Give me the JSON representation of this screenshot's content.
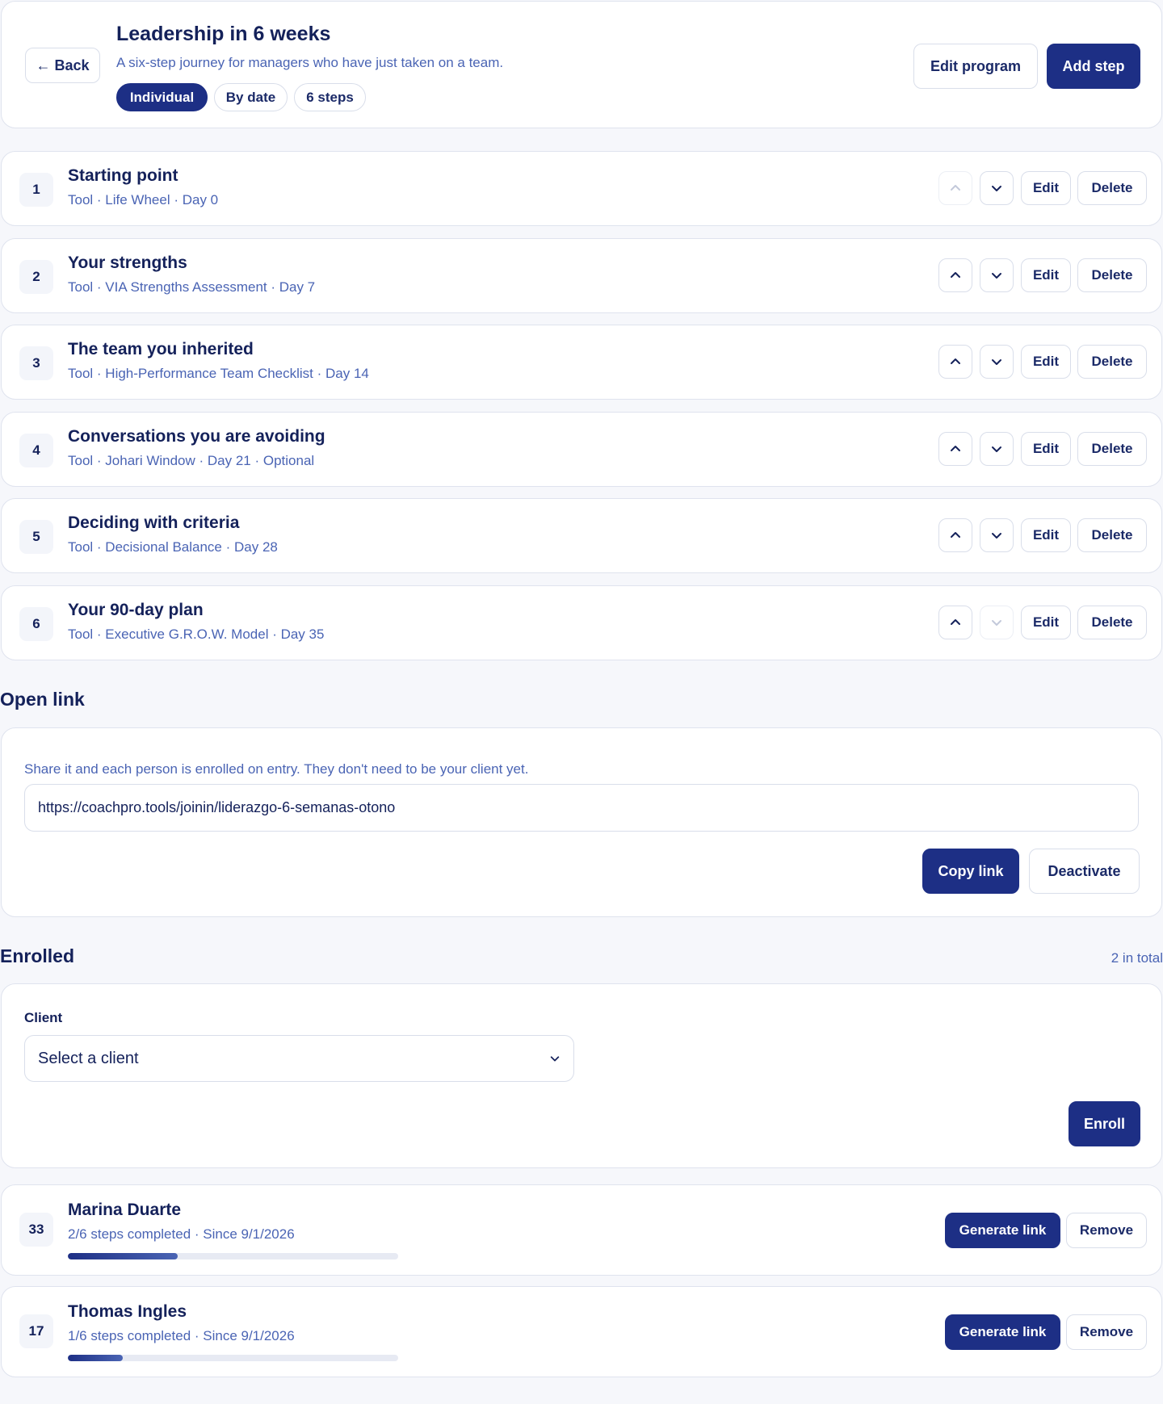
{
  "header": {
    "back_label": "← Back",
    "title": "Leadership in 6 weeks",
    "subtitle": "A six-step journey for managers who have just taken on a team.",
    "pills": [
      "Individual",
      "By date",
      "6 steps"
    ],
    "edit_program_label": "Edit program",
    "add_step_label": "Add step"
  },
  "steps": [
    {
      "number": "1",
      "title": "Starting point",
      "meta": "Tool · Life Wheel · Day 0",
      "up_enabled": false,
      "down_enabled": true
    },
    {
      "number": "2",
      "title": "Your strengths",
      "meta": "Tool · VIA Strengths Assessment · Day 7",
      "up_enabled": true,
      "down_enabled": true
    },
    {
      "number": "3",
      "title": "The team you inherited",
      "meta": "Tool · High-Performance Team Checklist · Day 14",
      "up_enabled": true,
      "down_enabled": true
    },
    {
      "number": "4",
      "title": "Conversations you are avoiding",
      "meta": "Tool · Johari Window · Day 21 · Optional",
      "up_enabled": true,
      "down_enabled": true
    },
    {
      "number": "5",
      "title": "Deciding with criteria",
      "meta": "Tool · Decisional Balance · Day 28",
      "up_enabled": true,
      "down_enabled": true
    },
    {
      "number": "6",
      "title": "Your 90-day plan",
      "meta": "Tool · Executive G.R.O.W. Model · Day 35",
      "up_enabled": true,
      "down_enabled": false
    }
  ],
  "step_actions": {
    "edit_label": "Edit",
    "delete_label": "Delete"
  },
  "open_link": {
    "section_title": "Open link",
    "description": "Share it and each person is enrolled on entry. They don't need to be your client yet.",
    "url": "https://coachpro.tools/joinin/liderazgo-6-semanas-otono",
    "copy_label": "Copy link",
    "deactivate_label": "Deactivate"
  },
  "enrolled": {
    "section_title": "Enrolled",
    "total": "2 in total",
    "client_label": "Client",
    "client_placeholder": "Select a client",
    "enroll_label": "Enroll",
    "generate_label": "Generate link",
    "remove_label": "Remove",
    "members": [
      {
        "number": "33",
        "name": "Marina Duarte",
        "meta": "2/6 steps completed · Since 9/1/2026",
        "progress": 0.333
      },
      {
        "number": "17",
        "name": "Thomas Ingles",
        "meta": "1/6 steps completed · Since 9/1/2026",
        "progress": 0.167
      }
    ]
  },
  "icons": {
    "up": "chevron-up-icon",
    "down": "chevron-down-icon"
  },
  "colors": {
    "primary": "#1d2f85",
    "text": "#14215a",
    "muted": "#4a64b4",
    "border": "#d9deea"
  }
}
